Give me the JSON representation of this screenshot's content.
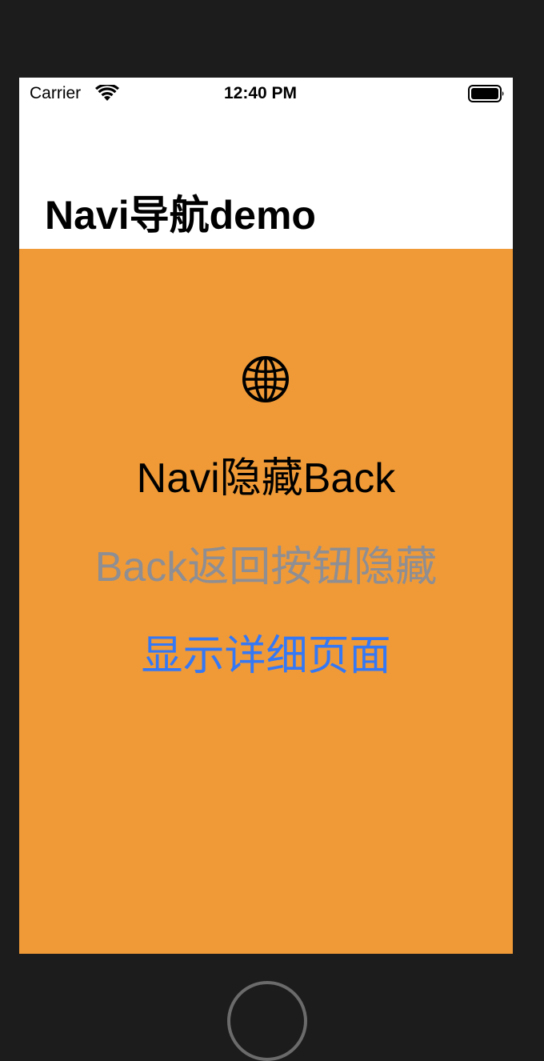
{
  "status_bar": {
    "carrier": "Carrier",
    "time": "12:40 PM",
    "wifi_icon": "wifi-icon",
    "battery_icon": "battery-icon"
  },
  "nav": {
    "title": "Navi导航demo"
  },
  "content": {
    "background_color": "#f09a37",
    "icon": "globe-icon",
    "label_primary": "Navi隐藏Back",
    "label_secondary": "Back返回按钮隐藏",
    "link_label": "显示详细页面",
    "link_color": "#3478f6",
    "secondary_color": "#8e8e93"
  }
}
